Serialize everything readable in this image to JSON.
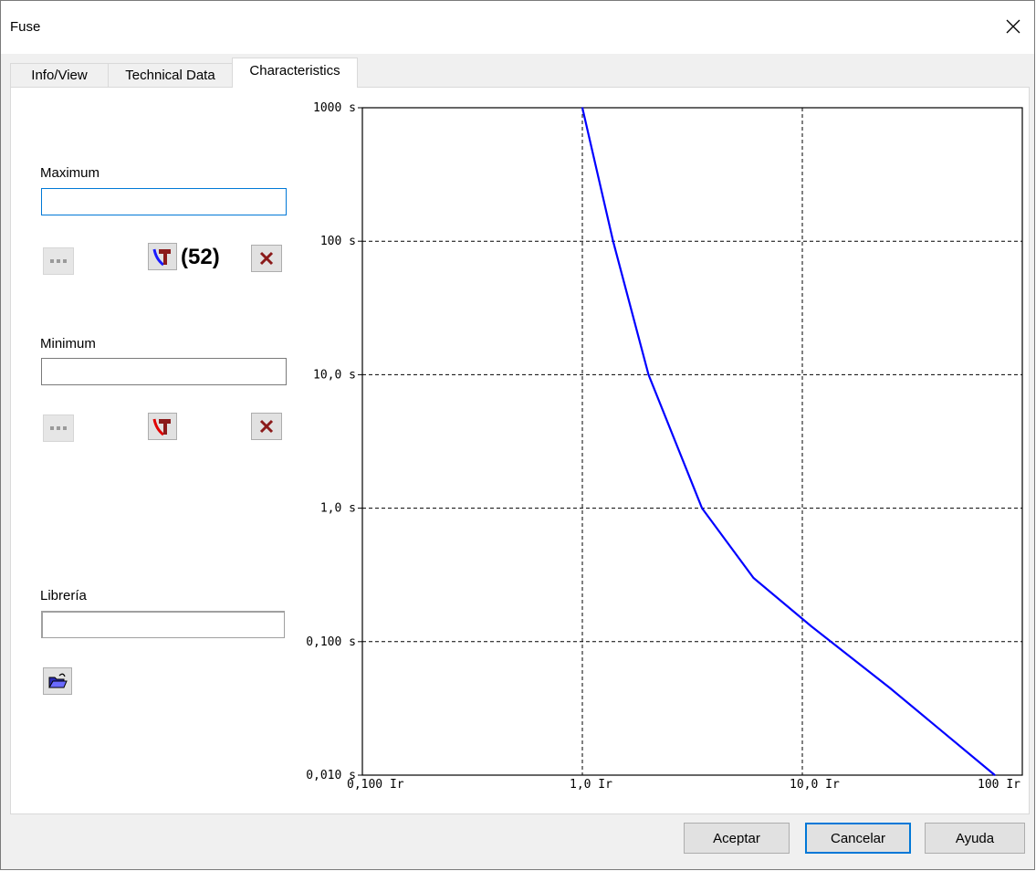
{
  "window": {
    "title": "Fuse"
  },
  "tabs": [
    {
      "label": "Info/View",
      "active": false
    },
    {
      "label": "Technical Data",
      "active": false
    },
    {
      "label": "Characteristics",
      "active": true
    }
  ],
  "maximum": {
    "label": "Maximum",
    "value": "",
    "curve_count": "(52)"
  },
  "minimum": {
    "label": "Minimum",
    "value": ""
  },
  "library": {
    "label": "Librería",
    "value": ""
  },
  "buttons": {
    "accept": "Aceptar",
    "cancel": "Cancelar",
    "help": "Ayuda"
  },
  "icons": {
    "browse": "ellipsis-icon",
    "curve_select": "curve-hammer-icon",
    "delete": "delete-x-icon",
    "open_folder": "open-folder-icon"
  },
  "colors": {
    "curve": "#0000ff",
    "focus": "#0078d7"
  },
  "chart_data": {
    "type": "line",
    "x_scale": "log",
    "y_scale": "log",
    "xlim": [
      0.1,
      100
    ],
    "ylim": [
      0.01,
      1000
    ],
    "x_ticks": [
      {
        "value": 0.1,
        "label": "0,100 Ir"
      },
      {
        "value": 1,
        "label": "1,0 Ir"
      },
      {
        "value": 10,
        "label": "10,0 Ir"
      },
      {
        "value": 100,
        "label": "100 Ir"
      }
    ],
    "y_ticks": [
      {
        "value": 0.01,
        "label": "0,010 s"
      },
      {
        "value": 0.1,
        "label": "0,100 s"
      },
      {
        "value": 1,
        "label": "1,0 s"
      },
      {
        "value": 10,
        "label": "10,0 s"
      },
      {
        "value": 100,
        "label": "100 s"
      },
      {
        "value": 1000,
        "label": "1000 s"
      }
    ],
    "grid": true,
    "grid_style": "dashed",
    "series": [
      {
        "x": [
          1.0,
          1.38,
          2.0,
          3.5,
          6.0,
          11.0,
          25.0,
          75.0
        ],
        "y": [
          1000,
          100,
          10,
          1.0,
          0.3,
          0.13,
          0.045,
          0.01
        ]
      }
    ]
  }
}
